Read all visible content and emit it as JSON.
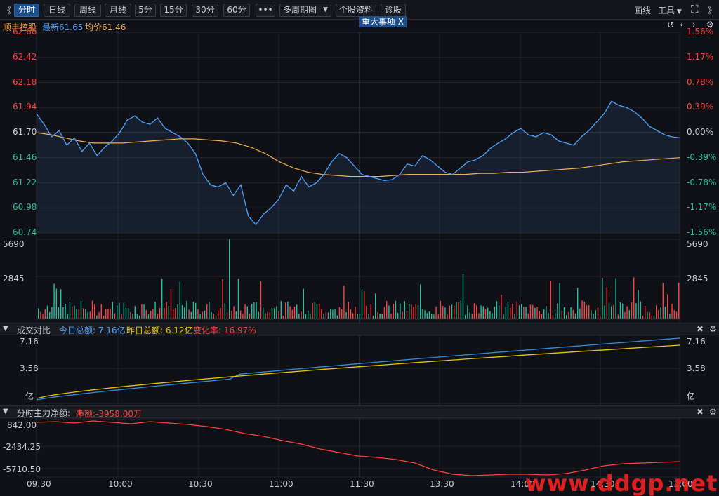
{
  "toolbar": {
    "back_glyph": "《",
    "tabs": [
      "分时",
      "日线",
      "周线",
      "月线",
      "5分",
      "15分",
      "30分",
      "60分",
      "•••"
    ],
    "multi_period": "多周期图",
    "profile": "个股资料",
    "diagnose": "诊股",
    "draw_line": "画线",
    "tools": "工具",
    "forward_glyph": "》"
  },
  "quote": {
    "name": "顺丰控股",
    "latest_label": "最新61.65",
    "avg_label": "均价61.46",
    "event_label": "重大事项",
    "event_close": "X"
  },
  "price_axis": {
    "left": [
      "62.66",
      "62.42",
      "62.18",
      "61.94",
      "61.70",
      "61.46",
      "61.22",
      "60.98",
      "60.74"
    ],
    "right": [
      "1.56%",
      "1.17%",
      "0.78%",
      "0.39%",
      "0.00%",
      "-0.39%",
      "-0.78%",
      "-1.17%",
      "-1.56%"
    ]
  },
  "volume_axis": {
    "top": "5690",
    "mid": "2845"
  },
  "turnover_panel": {
    "title": "成交对比",
    "today": "今日总额: 7.16亿",
    "yesterday": "昨日总额: 6.12亿",
    "change": "变化率: 16.97%",
    "axis": [
      "7.16",
      "3.58",
      "亿"
    ]
  },
  "flow_panel": {
    "title": "分时主力净额:",
    "net": "净额:-3958.00万",
    "axis": [
      "842.00",
      "-2434.25",
      "-5710.50"
    ]
  },
  "time_axis": [
    "09:30",
    "10:00",
    "10:30",
    "11:00",
    "11:30",
    "13:30",
    "14:00",
    "14:30",
    "15:00"
  ],
  "watermark": "www.ddgp.net",
  "colors": {
    "price_line": "#4aa3ff",
    "avg_line": "#f0b050",
    "up": "#ff4040",
    "down": "#20c0a0",
    "today_turnover": "#2f8fe0",
    "yesterday_turnover": "#e6c800",
    "flow_line": "#ff4040"
  },
  "chart_data": {
    "type": "line",
    "x_ticks": [
      "09:30",
      "10:00",
      "10:30",
      "11:00",
      "11:30",
      "13:30",
      "14:00",
      "14:30",
      "15:00"
    ],
    "ylim": [
      60.74,
      62.66
    ],
    "reference": 61.7,
    "series": [
      {
        "values": [
          61.88,
          61.78,
          61.66,
          61.72,
          61.58,
          61.65,
          61.52,
          61.6,
          61.48,
          61.56,
          61.62,
          61.7,
          61.82,
          61.86,
          61.8,
          61.78,
          61.84,
          61.74,
          61.7,
          61.66,
          61.6,
          61.5,
          61.3,
          61.2,
          61.18,
          61.22,
          61.1,
          61.2,
          60.9,
          60.82,
          60.92,
          60.98,
          61.06,
          61.2,
          61.14,
          61.28,
          61.18,
          61.22,
          61.3,
          61.42,
          61.5,
          61.46,
          61.38,
          61.3,
          61.28,
          61.26,
          61.24,
          61.25,
          61.3,
          61.4,
          61.38,
          61.48,
          61.44,
          61.38,
          61.32,
          61.3,
          61.36,
          61.42,
          61.44,
          61.48,
          61.55,
          61.6,
          61.64,
          61.7,
          61.74,
          61.68,
          61.66,
          61.7,
          61.68,
          61.62,
          61.6,
          61.58,
          61.66,
          61.72,
          61.8,
          61.88,
          62.0,
          61.96,
          61.94,
          61.9,
          61.84,
          61.76,
          61.72,
          61.68,
          61.66,
          61.65
        ]
      },
      {
        "values": [
          61.7,
          61.68,
          61.65,
          61.62,
          61.6,
          61.6,
          61.6,
          61.61,
          61.62,
          61.63,
          61.64,
          61.64,
          61.63,
          61.62,
          61.6,
          61.56,
          61.5,
          61.42,
          61.36,
          61.32,
          61.3,
          61.29,
          61.28,
          61.28,
          61.28,
          61.29,
          61.3,
          61.3,
          61.3,
          61.3,
          61.3,
          61.31,
          61.31,
          61.32,
          61.32,
          61.33,
          61.34,
          61.35,
          61.36,
          61.38,
          61.4,
          61.42,
          61.43,
          61.44,
          61.45,
          61.46
        ]
      }
    ]
  }
}
